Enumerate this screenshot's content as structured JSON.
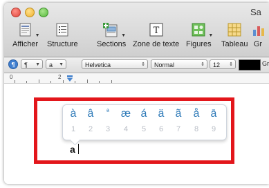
{
  "window": {
    "title": "Sa"
  },
  "toolbar": {
    "view_label": "Afficher",
    "outline_label": "Structure",
    "sections_label": "Sections",
    "textbox_label": "Zone de texte",
    "shapes_label": "Figures",
    "table_label": "Tableau",
    "more_label": "Gr"
  },
  "format_bar": {
    "paragraph_symbol": "¶",
    "char_style": "a",
    "font_family": "Helvetica",
    "font_style": "Normal",
    "font_size": "12",
    "right_cutoff": "Gr"
  },
  "ruler": {
    "labels": [
      "0",
      "2"
    ]
  },
  "accent_popup": {
    "characters": [
      "à",
      "â",
      "ª",
      "æ",
      "á",
      "ä",
      "ã",
      "å",
      "ā"
    ],
    "numbers": [
      "1",
      "2",
      "3",
      "4",
      "5",
      "6",
      "7",
      "8",
      "9"
    ]
  },
  "document": {
    "typed_text": "a"
  },
  "colors": {
    "highlight_border": "#e3161b",
    "accent_text": "#2e7ab8",
    "number_text": "#b9bec6"
  }
}
